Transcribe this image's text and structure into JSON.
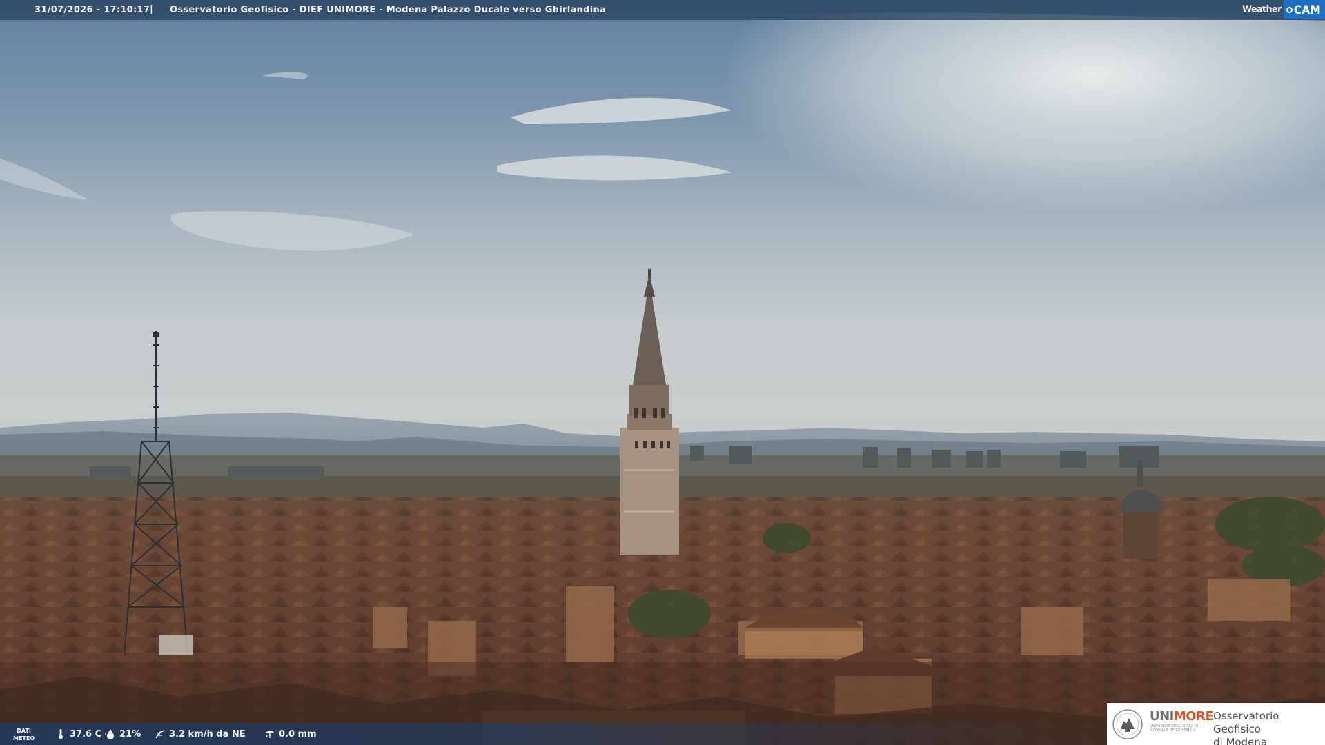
{
  "top_bar": {
    "timestamp": "31/07/2026 - 17:10:17",
    "separator": "|",
    "camera_title": "Osservatorio Geofisico - DIEF UNIMORE - Modena Palazzo Ducale verso Ghirlandina"
  },
  "brand": {
    "weather_text": "Weather",
    "cam_text": "CAM"
  },
  "meteo": {
    "label_line1": "DATI",
    "label_line2": "METEO",
    "temperature": "37.6 C",
    "humidity": "21%",
    "wind": "3.2 km/h da NE",
    "rain": "0.0 mm",
    "icons": [
      "thermometer-icon",
      "humidity-icon",
      "wind-icon",
      "rain-gauge-icon"
    ]
  },
  "logo": {
    "uni": "UNI",
    "more": "MORE",
    "university_caption": "UNIVERSITÀ DEGLI STUDI DI MODENA E REGGIO EMILIA",
    "observatory_line1": "Osservatorio Geofisico",
    "observatory_line2": "di Modena"
  },
  "colors": {
    "sky_top": "#6f8aa6",
    "sky_haze": "#c9cfd2",
    "roof_red": "#8a4a33",
    "bar_blue": "#284260",
    "cam_blue": "#1c6fc2",
    "unimore_orange": "#d8552a"
  }
}
